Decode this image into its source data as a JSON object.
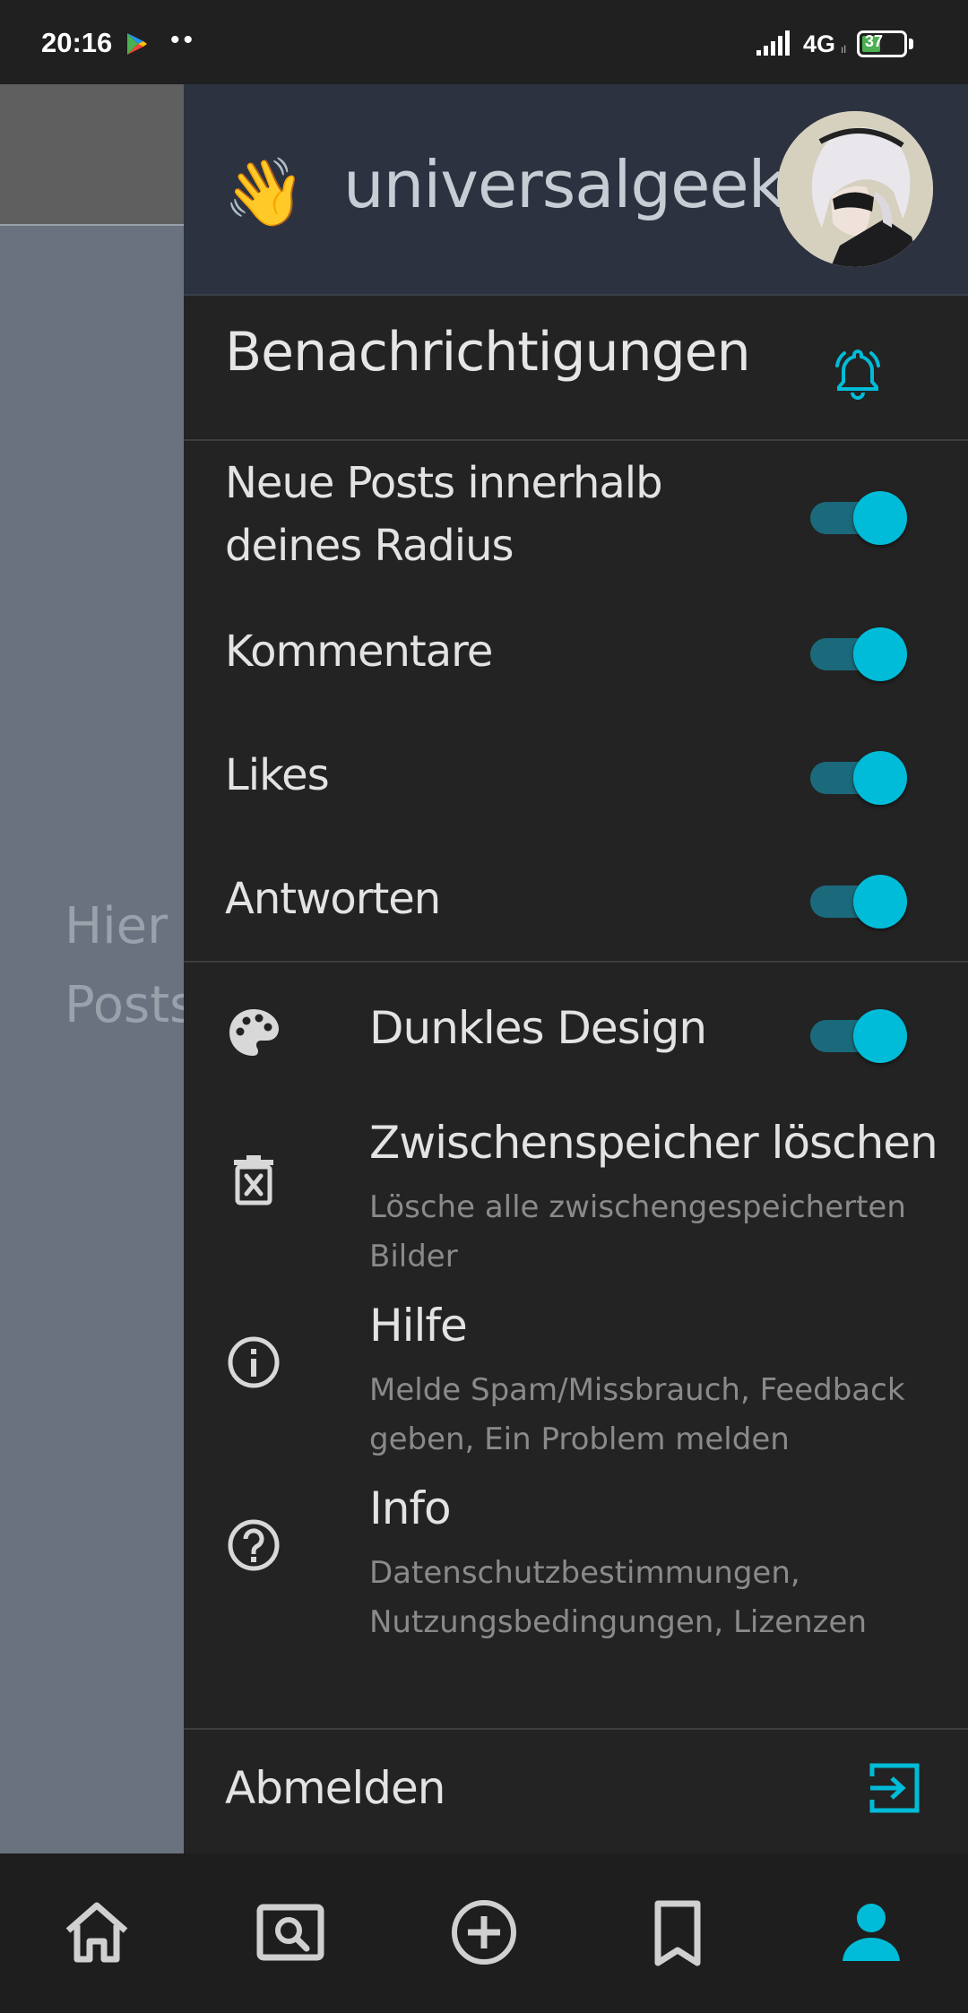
{
  "status_bar": {
    "time": "20:16",
    "dots": "••",
    "network": "4G",
    "network_sub": "ıl",
    "battery_level": "37"
  },
  "background": {
    "text": "Hier f\nPosts"
  },
  "drawer": {
    "header": {
      "greeting_emoji": "👋",
      "username": "universalgeek"
    },
    "notifications": {
      "title": "Benachrichtigungen",
      "items": [
        {
          "label": "Neue Posts innerhalb deines Radius",
          "enabled": true
        },
        {
          "label": "Kommentare",
          "enabled": true
        },
        {
          "label": "Likes",
          "enabled": true
        },
        {
          "label": "Antworten",
          "enabled": true
        }
      ]
    },
    "settings": {
      "dark_mode": {
        "label": "Dunkles Design",
        "icon": "palette-icon",
        "enabled": true
      },
      "clear_cache": {
        "title": "Zwischenspeicher löschen",
        "subtitle": "Lösche alle zwischengespeicherten Bilder",
        "icon": "trash-icon"
      },
      "help": {
        "title": "Hilfe",
        "subtitle": "Melde Spam/Missbrauch, Feedback geben, Ein Problem melden",
        "icon": "info-icon"
      },
      "info": {
        "title": "Info",
        "subtitle": "Datenschutzbestimmungen, Nutzungsbedingungen, Lizenzen",
        "icon": "question-icon"
      }
    },
    "logout": {
      "label": "Abmelden",
      "icon": "logout-icon"
    }
  },
  "bottom_nav": {
    "items": [
      "home-icon",
      "search-icon",
      "add-icon",
      "bookmark-icon",
      "profile-icon"
    ],
    "active": "profile-icon"
  },
  "colors": {
    "accent": "#00bcd8",
    "toggle_track": "#1b6a7c",
    "drawer_bg": "#232323",
    "header_bg": "#2c3240"
  }
}
